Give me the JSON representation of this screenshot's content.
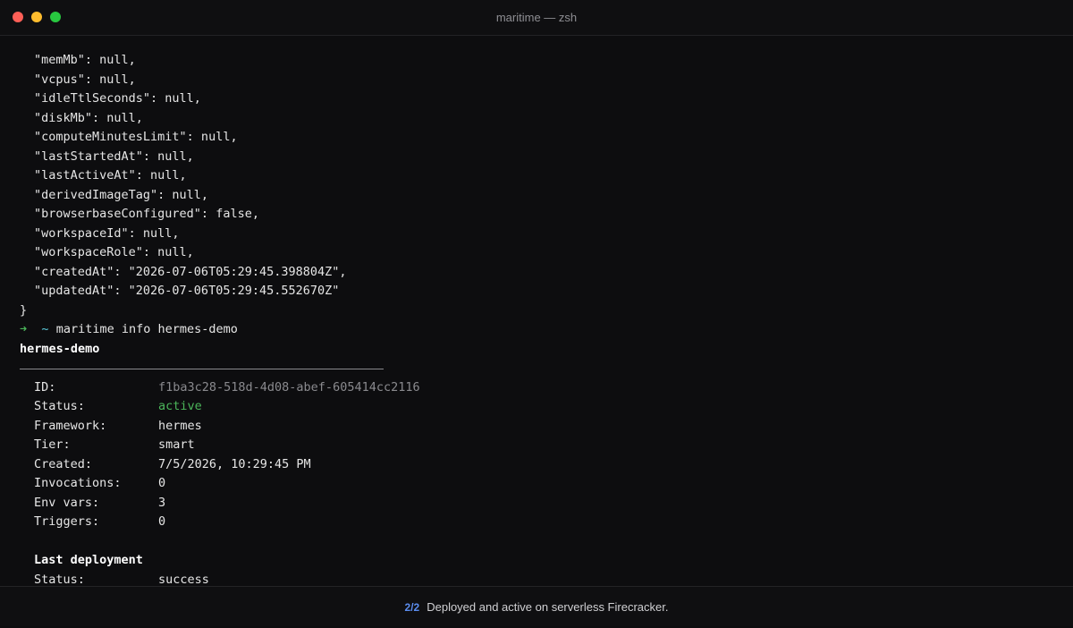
{
  "window": {
    "title": "maritime — zsh"
  },
  "terminal": {
    "json_lines": [
      "\"memMb\": null,",
      "\"vcpus\": null,",
      "\"idleTtlSeconds\": null,",
      "\"diskMb\": null,",
      "\"computeMinutesLimit\": null,",
      "\"lastStartedAt\": null,",
      "\"lastActiveAt\": null,",
      "\"derivedImageTag\": null,",
      "\"browserbaseConfigured\": false,",
      "\"workspaceId\": null,",
      "\"workspaceRole\": null,",
      "\"createdAt\": \"2026-07-06T05:29:45.398804Z\",",
      "\"updatedAt\": \"2026-07-06T05:29:45.552670Z\""
    ],
    "closing_brace": "}",
    "prompt": {
      "arrow": "➜",
      "dir": "~",
      "command": "maritime info hermes-demo"
    },
    "heading": "hermes-demo",
    "info": {
      "id_label": "ID:",
      "id_value": "f1ba3c28-518d-4d08-abef-605414cc2116",
      "status_label": "Status:",
      "status_value": "active",
      "framework_label": "Framework:",
      "framework_value": "hermes",
      "tier_label": "Tier:",
      "tier_value": "smart",
      "created_label": "Created:",
      "created_value": "7/5/2026, 10:29:45 PM",
      "invocations_label": "Invocations:",
      "invocations_value": "0",
      "envvars_label": "Env vars:",
      "envvars_value": "3",
      "triggers_label": "Triggers:",
      "triggers_value": "0"
    },
    "last_deployment": {
      "heading": "Last deployment",
      "status_label": "Status:",
      "status_value": "success"
    }
  },
  "statusbar": {
    "step": "2/2",
    "message": "Deployed and active on serverless Firecracker."
  },
  "colors": {
    "background": "#0d0d0f",
    "accent_green": "#4bb55a",
    "accent_cyan": "#5ac8d8",
    "step_blue": "#5b8def"
  }
}
